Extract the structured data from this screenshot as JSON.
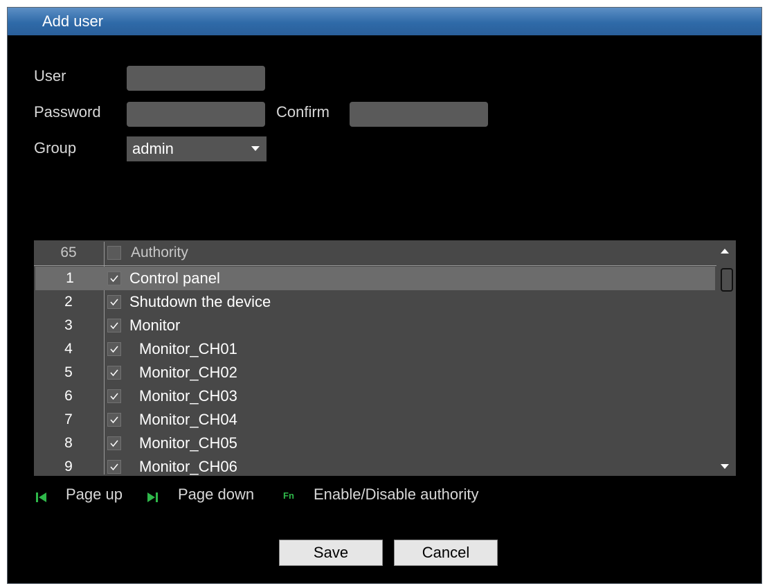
{
  "window": {
    "title": "Add user"
  },
  "form": {
    "user_label": "User",
    "user_value": "",
    "password_label": "Password",
    "password_value": "",
    "confirm_label": "Confirm",
    "confirm_value": "",
    "group_label": "Group",
    "group_selected": "admin"
  },
  "authority_table": {
    "count": "65",
    "header": "Authority",
    "rows": [
      {
        "num": "1",
        "label": "Control panel",
        "checked": true,
        "selected": true
      },
      {
        "num": "2",
        "label": "Shutdown the device",
        "checked": true
      },
      {
        "num": "3",
        "label": "Monitor",
        "checked": true
      },
      {
        "num": "4",
        "label": "Monitor_CH01",
        "checked": true
      },
      {
        "num": "5",
        "label": "Monitor_CH02",
        "checked": true
      },
      {
        "num": "6",
        "label": "Monitor_CH03",
        "checked": true
      },
      {
        "num": "7",
        "label": "Monitor_CH04",
        "checked": true
      },
      {
        "num": "8",
        "label": "Monitor_CH05",
        "checked": true
      },
      {
        "num": "9",
        "label": "Monitor_CH06",
        "checked": true
      }
    ]
  },
  "hints": {
    "page_up": "Page up",
    "page_down": "Page down",
    "fn_key": "Fn",
    "enable_disable": "Enable/Disable authority"
  },
  "buttons": {
    "save": "Save",
    "cancel": "Cancel"
  },
  "colors": {
    "title_bar": "#2f6aa8",
    "hint_icon": "#2fb84a"
  }
}
